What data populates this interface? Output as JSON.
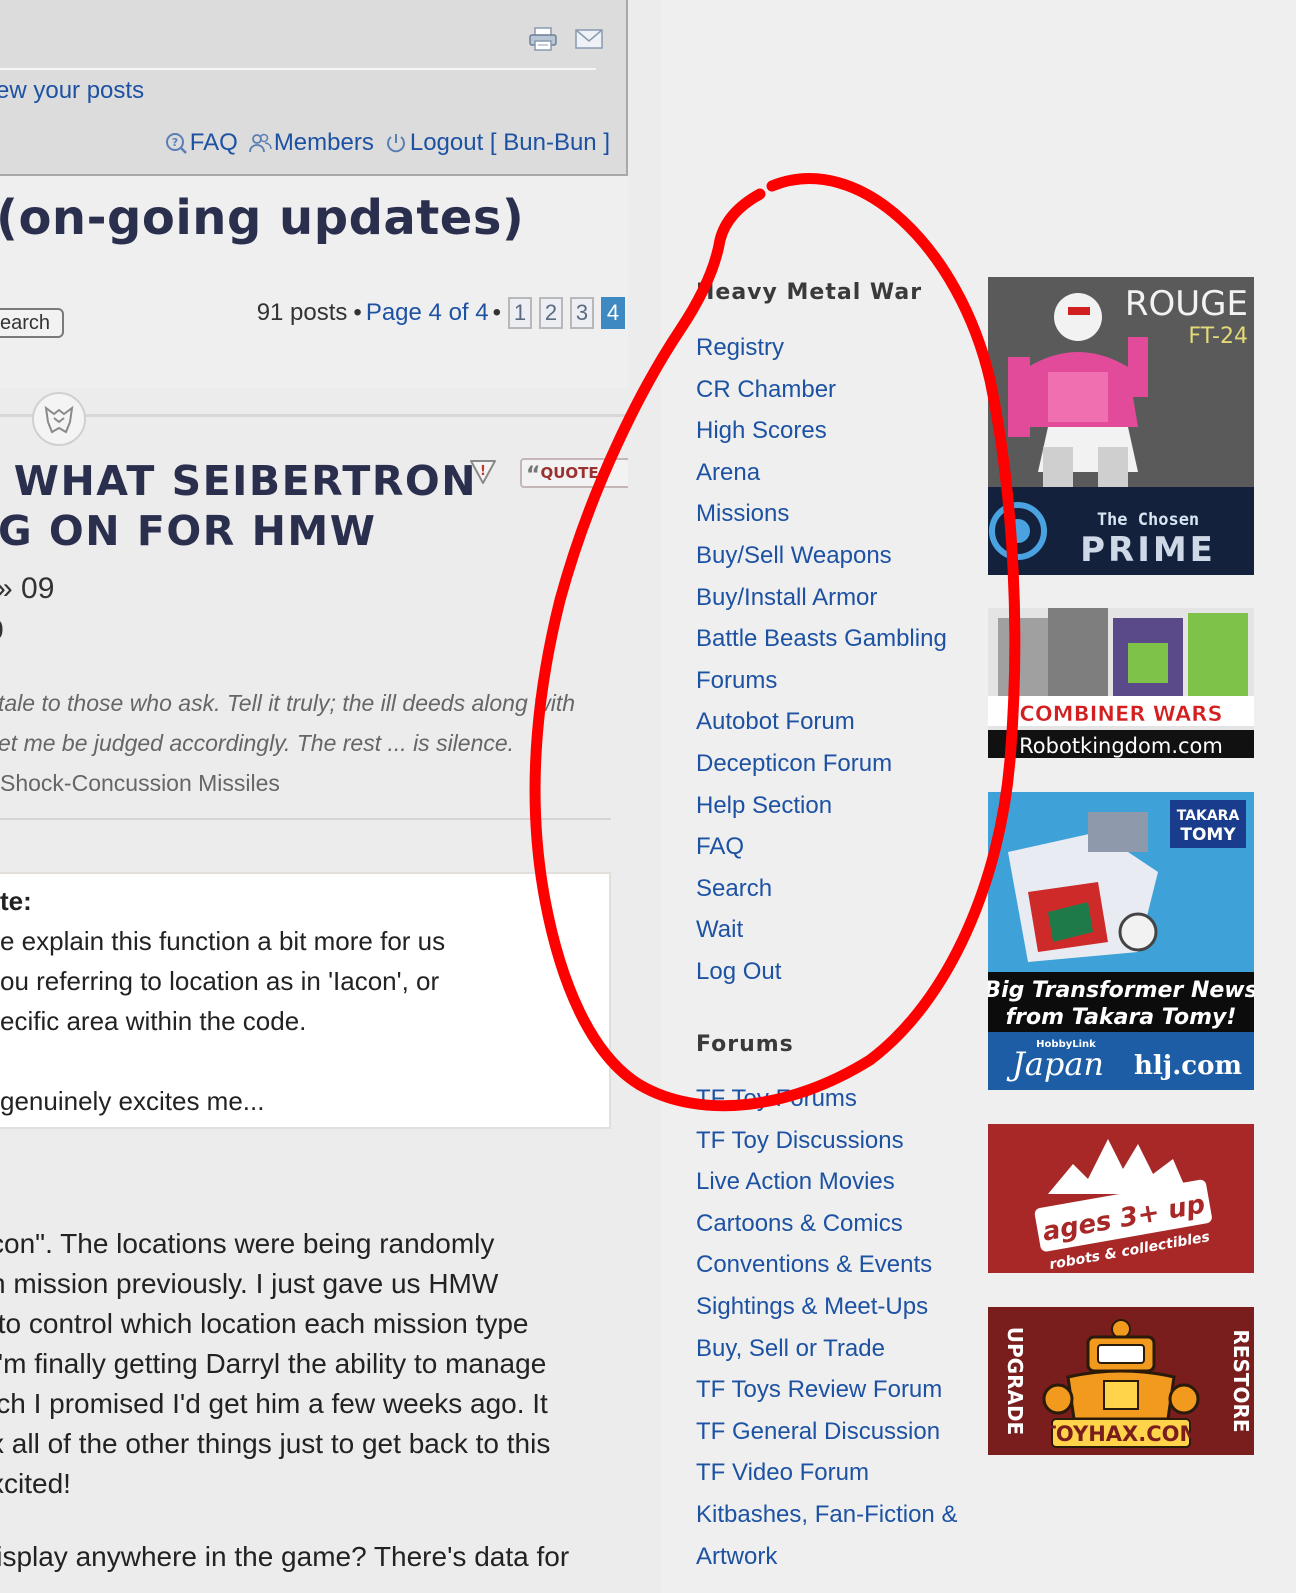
{
  "header": {
    "view_posts_link": "ew your posts",
    "faq_label": "FAQ",
    "members_label": "Members",
    "logout_label": "Logout [ Bun-Bun ]",
    "print_icon": "print-icon",
    "mail_icon": "envelope-icon"
  },
  "topic": {
    "title": "(on-going updates)",
    "search_button": "earch",
    "post_count": "91 posts",
    "separator": "•",
    "page_of": "Page 4 of 4",
    "pages": [
      "1",
      "2",
      "3",
      "4"
    ],
    "current_page": "4"
  },
  "post": {
    "title_line1": " WHAT SEIBERTRON",
    "title_line2": "G ON FOR HMW",
    "quote_button": "QUOTE",
    "date_line1": "» 09",
    "date_line2": "0",
    "signature_line1": "tale to those who ask. Tell it truly; the ill deeds along with",
    "signature_line2": "et me be judged accordingly. The rest ... is silence.",
    "signature_line3": "Shock-Concussion Missiles",
    "quote": {
      "head": "te:",
      "line1": "e explain this function a bit more for us",
      "line2": "ou referring to location as in 'Iacon', or",
      "line3": "ecific area within the code.",
      "line4": "genuinely excites me..."
    },
    "body": [
      "con\". The locations were being randomly",
      "h mission previously. I just gave us HMW",
      " to control which location each mission type",
      "I'm finally getting Darryl the ability to manage",
      "ich I promised I'd get him a few weeks ago. It",
      "x all of the other things just to get back to this",
      "xcited!",
      "lisplay anywhere in the game? There's data for"
    ]
  },
  "sidebar": {
    "hmw_heading": "Heavy Metal War",
    "hmw_links": [
      "Registry",
      "CR Chamber",
      "High Scores",
      "Arena",
      "Missions",
      "Buy/Sell Weapons",
      "Buy/Install Armor",
      "Battle Beasts Gambling",
      "Forums",
      "Autobot Forum",
      "Decepticon Forum",
      "Help Section",
      "FAQ",
      "Search",
      "Wait",
      "Log Out"
    ],
    "forums_heading": "Forums",
    "forum_links": [
      "TF Toy Forums",
      "TF Toy Discussions",
      "Live Action Movies",
      "Cartoons & Comics",
      "Conventions & Events",
      "Sightings & Meet-Ups",
      "Buy, Sell or Trade",
      "TF Toys Review Forum",
      "TF General Discussion",
      "TF Video Forum",
      "Kitbashes, Fan-Fiction &",
      "Artwork"
    ]
  },
  "ads": {
    "ad1": {
      "title": "ROUGE",
      "code": "FT-24",
      "banner_top": "The Chosen",
      "banner_bottom": "PRIME"
    },
    "ad2": {
      "banner": "COMBINER WARS",
      "site": "Robotkingdom.com"
    },
    "ad3": {
      "brand_top": "TAKARA",
      "brand_bottom": "TOMY",
      "line1": "Big Transformer News",
      "line2": "from Takara Tomy!",
      "hobbylink": "HobbyLink",
      "japan": "Japan",
      "site": "hlj.com"
    },
    "ad4": {
      "main": "ages 3+ up",
      "sub": "robots & collectibles"
    },
    "ad5": {
      "left": "UPGRADE",
      "right": "RESTORE",
      "site": "TOYHAX.COM"
    }
  },
  "colors": {
    "link": "#1d52a3",
    "annotation": "#ff0000",
    "page_current": "#3f89c3"
  }
}
